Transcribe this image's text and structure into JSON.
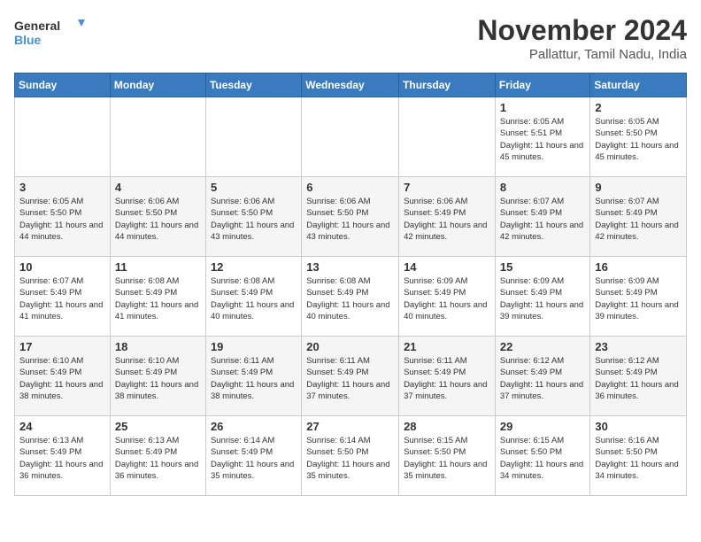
{
  "logo": {
    "line1": "General",
    "line2": "Blue"
  },
  "title": "November 2024",
  "subtitle": "Pallattur, Tamil Nadu, India",
  "days_of_week": [
    "Sunday",
    "Monday",
    "Tuesday",
    "Wednesday",
    "Thursday",
    "Friday",
    "Saturday"
  ],
  "weeks": [
    [
      {
        "day": "",
        "info": ""
      },
      {
        "day": "",
        "info": ""
      },
      {
        "day": "",
        "info": ""
      },
      {
        "day": "",
        "info": ""
      },
      {
        "day": "",
        "info": ""
      },
      {
        "day": "1",
        "info": "Sunrise: 6:05 AM\nSunset: 5:51 PM\nDaylight: 11 hours and 45 minutes."
      },
      {
        "day": "2",
        "info": "Sunrise: 6:05 AM\nSunset: 5:50 PM\nDaylight: 11 hours and 45 minutes."
      }
    ],
    [
      {
        "day": "3",
        "info": "Sunrise: 6:05 AM\nSunset: 5:50 PM\nDaylight: 11 hours and 44 minutes."
      },
      {
        "day": "4",
        "info": "Sunrise: 6:06 AM\nSunset: 5:50 PM\nDaylight: 11 hours and 44 minutes."
      },
      {
        "day": "5",
        "info": "Sunrise: 6:06 AM\nSunset: 5:50 PM\nDaylight: 11 hours and 43 minutes."
      },
      {
        "day": "6",
        "info": "Sunrise: 6:06 AM\nSunset: 5:50 PM\nDaylight: 11 hours and 43 minutes."
      },
      {
        "day": "7",
        "info": "Sunrise: 6:06 AM\nSunset: 5:49 PM\nDaylight: 11 hours and 42 minutes."
      },
      {
        "day": "8",
        "info": "Sunrise: 6:07 AM\nSunset: 5:49 PM\nDaylight: 11 hours and 42 minutes."
      },
      {
        "day": "9",
        "info": "Sunrise: 6:07 AM\nSunset: 5:49 PM\nDaylight: 11 hours and 42 minutes."
      }
    ],
    [
      {
        "day": "10",
        "info": "Sunrise: 6:07 AM\nSunset: 5:49 PM\nDaylight: 11 hours and 41 minutes."
      },
      {
        "day": "11",
        "info": "Sunrise: 6:08 AM\nSunset: 5:49 PM\nDaylight: 11 hours and 41 minutes."
      },
      {
        "day": "12",
        "info": "Sunrise: 6:08 AM\nSunset: 5:49 PM\nDaylight: 11 hours and 40 minutes."
      },
      {
        "day": "13",
        "info": "Sunrise: 6:08 AM\nSunset: 5:49 PM\nDaylight: 11 hours and 40 minutes."
      },
      {
        "day": "14",
        "info": "Sunrise: 6:09 AM\nSunset: 5:49 PM\nDaylight: 11 hours and 40 minutes."
      },
      {
        "day": "15",
        "info": "Sunrise: 6:09 AM\nSunset: 5:49 PM\nDaylight: 11 hours and 39 minutes."
      },
      {
        "day": "16",
        "info": "Sunrise: 6:09 AM\nSunset: 5:49 PM\nDaylight: 11 hours and 39 minutes."
      }
    ],
    [
      {
        "day": "17",
        "info": "Sunrise: 6:10 AM\nSunset: 5:49 PM\nDaylight: 11 hours and 38 minutes."
      },
      {
        "day": "18",
        "info": "Sunrise: 6:10 AM\nSunset: 5:49 PM\nDaylight: 11 hours and 38 minutes."
      },
      {
        "day": "19",
        "info": "Sunrise: 6:11 AM\nSunset: 5:49 PM\nDaylight: 11 hours and 38 minutes."
      },
      {
        "day": "20",
        "info": "Sunrise: 6:11 AM\nSunset: 5:49 PM\nDaylight: 11 hours and 37 minutes."
      },
      {
        "day": "21",
        "info": "Sunrise: 6:11 AM\nSunset: 5:49 PM\nDaylight: 11 hours and 37 minutes."
      },
      {
        "day": "22",
        "info": "Sunrise: 6:12 AM\nSunset: 5:49 PM\nDaylight: 11 hours and 37 minutes."
      },
      {
        "day": "23",
        "info": "Sunrise: 6:12 AM\nSunset: 5:49 PM\nDaylight: 11 hours and 36 minutes."
      }
    ],
    [
      {
        "day": "24",
        "info": "Sunrise: 6:13 AM\nSunset: 5:49 PM\nDaylight: 11 hours and 36 minutes."
      },
      {
        "day": "25",
        "info": "Sunrise: 6:13 AM\nSunset: 5:49 PM\nDaylight: 11 hours and 36 minutes."
      },
      {
        "day": "26",
        "info": "Sunrise: 6:14 AM\nSunset: 5:49 PM\nDaylight: 11 hours and 35 minutes."
      },
      {
        "day": "27",
        "info": "Sunrise: 6:14 AM\nSunset: 5:50 PM\nDaylight: 11 hours and 35 minutes."
      },
      {
        "day": "28",
        "info": "Sunrise: 6:15 AM\nSunset: 5:50 PM\nDaylight: 11 hours and 35 minutes."
      },
      {
        "day": "29",
        "info": "Sunrise: 6:15 AM\nSunset: 5:50 PM\nDaylight: 11 hours and 34 minutes."
      },
      {
        "day": "30",
        "info": "Sunrise: 6:16 AM\nSunset: 5:50 PM\nDaylight: 11 hours and 34 minutes."
      }
    ]
  ]
}
